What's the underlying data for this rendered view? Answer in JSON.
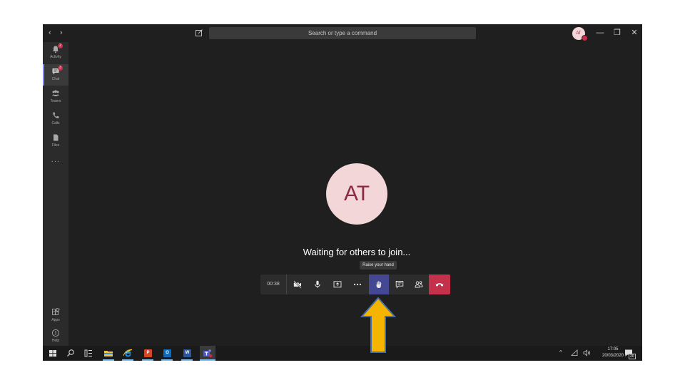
{
  "titlebar": {
    "back": "‹",
    "forward": "›",
    "search_placeholder": "Search or type a command",
    "me_initials": "AT",
    "minimize": "—",
    "maximize": "❐",
    "close": "✕"
  },
  "sidebar": {
    "items": [
      {
        "label": "Activity",
        "badge": "2",
        "icon": "bell-icon"
      },
      {
        "label": "Chat",
        "badge": "3",
        "icon": "chat-icon"
      },
      {
        "label": "Teams",
        "badge": "",
        "icon": "teams-icon"
      },
      {
        "label": "Calls",
        "badge": "",
        "icon": "phone-icon"
      },
      {
        "label": "Files",
        "badge": "",
        "icon": "file-icon"
      }
    ],
    "more": "···",
    "apps_label": "Apps",
    "help_label": "Help"
  },
  "call": {
    "participant_initials": "AT",
    "status": "Waiting for others to join...",
    "timer": "00:38",
    "tooltip": "Raise your hand"
  },
  "taskbar": {
    "time": "17:05",
    "date": "20/03/2020",
    "notifications": "20",
    "ppt_letter": "P",
    "outlook_letter": "O",
    "word_letter": "W"
  },
  "colors": {
    "accent": "#444791",
    "hangup": "#c4314b",
    "avatar_bg": "#f3d6d8",
    "avatar_text": "#8b2a3c",
    "arrow_fill": "#f5b400",
    "arrow_stroke": "#4a6fa5"
  }
}
